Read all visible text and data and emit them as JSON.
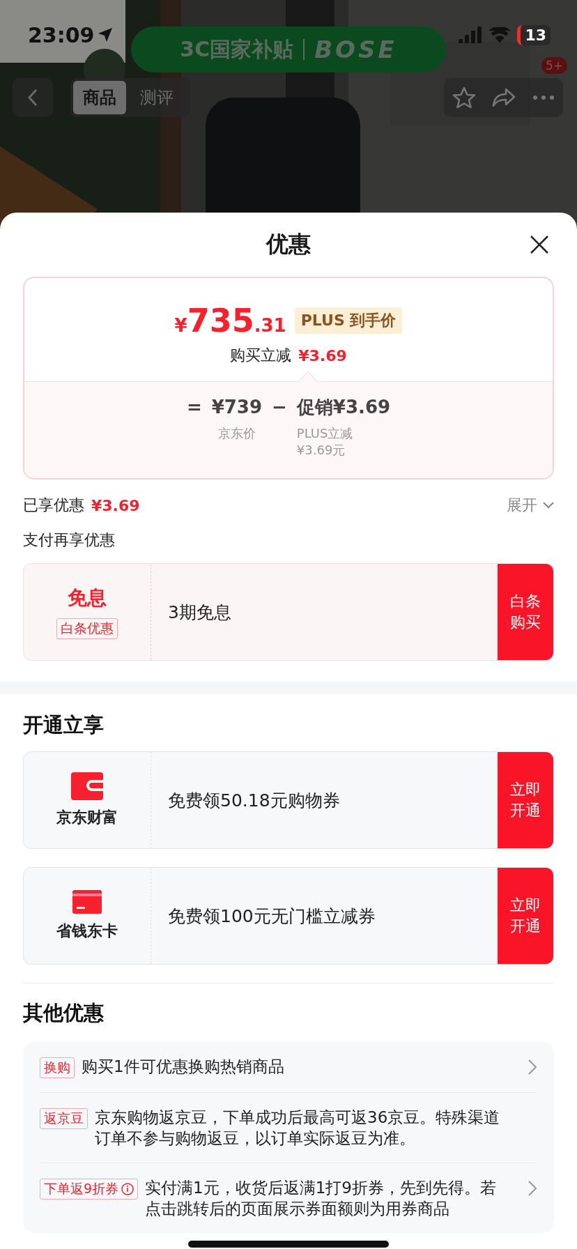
{
  "status_bar": {
    "time": "23:09",
    "battery": "13"
  },
  "banner": {
    "text": "3C国家补贴",
    "brand": "BOSE"
  },
  "nav": {
    "tabs": [
      {
        "label": "商品",
        "selected": true
      },
      {
        "label": "测评",
        "selected": false
      }
    ],
    "badge": "5+"
  },
  "sheet": {
    "title": "优惠"
  },
  "price_card": {
    "currency": "¥",
    "price_int": "735",
    "price_dec": ".31",
    "tag": "PLUS 到手价",
    "discount_label": "购买立减",
    "discount_value": "¥3.69",
    "equals": "=",
    "base_price": "¥739",
    "base_label": "京东价",
    "minus": "−",
    "promo": "促销¥3.69",
    "promo_note": [
      "PLUS立减",
      "¥3.69元"
    ]
  },
  "savings": {
    "label": "已享优惠",
    "value": "¥3.69",
    "toggle": "展开",
    "expanded": false
  },
  "pay_section": {
    "title": "支付再享优惠",
    "offers": [
      {
        "kind": "badge",
        "headline": "免息",
        "tag": "白条优惠",
        "description": "3期免息",
        "action": "白条购买"
      }
    ]
  },
  "open_section": {
    "title": "开通立享",
    "offers": [
      {
        "kind": "wallet",
        "name": "京东财富",
        "description": "免费领50.18元购物券",
        "action": "立即开通"
      },
      {
        "kind": "card",
        "name": "省钱东卡",
        "description": "免费领100元无门槛立减券",
        "action": "立即开通"
      }
    ]
  },
  "other_section": {
    "title": "其他优惠",
    "items": [
      {
        "tag": "换购",
        "info": false,
        "text": "购买1件可优惠换购热销商品",
        "arrow": true
      },
      {
        "tag": "返京豆",
        "info": false,
        "text": "京东购物返京豆，下单成功后最高可返36京豆。特殊渠道订单不参与购物返豆，以订单实际返豆为准。",
        "arrow": false
      },
      {
        "tag": "下单返9折券",
        "info": true,
        "text": "实付满1元，收货后返满1打9折券，先到先得。若点击跳转后的页面展示券面额则为用券商品",
        "arrow": true
      }
    ]
  }
}
